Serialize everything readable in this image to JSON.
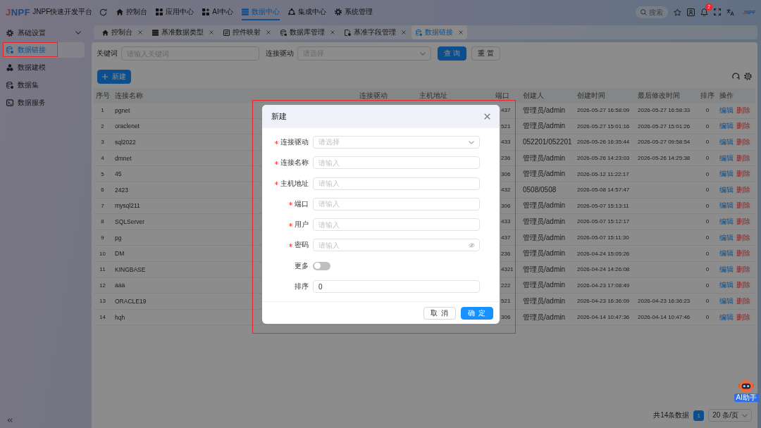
{
  "topbar": {
    "logo": "JNPF",
    "app_title": "JNPF快速开发平台",
    "nav": [
      {
        "label": "控制台",
        "selected": false
      },
      {
        "label": "应用中心",
        "selected": false
      },
      {
        "label": "AI中心",
        "selected": false
      },
      {
        "label": "数据中心",
        "selected": true
      },
      {
        "label": "集成中心",
        "selected": false
      },
      {
        "label": "系统管理",
        "selected": false
      }
    ],
    "search": {
      "placeholder": "搜索"
    },
    "notification_badge": "2",
    "corner_logo": "JNPF"
  },
  "sidebar": {
    "group": {
      "label": "基础设置",
      "expanded": false
    },
    "items": [
      {
        "label": "数据链接",
        "selected": true,
        "highlighted": true
      },
      {
        "label": "数据建模",
        "selected": false,
        "highlighted": false
      },
      {
        "label": "数据集",
        "selected": false,
        "highlighted": false
      },
      {
        "label": "数据服务",
        "selected": false,
        "highlighted": false
      }
    ]
  },
  "tabs": [
    {
      "label": "控制台",
      "selected": false
    },
    {
      "label": "基准数据类型",
      "selected": false
    },
    {
      "label": "控件映射",
      "selected": false
    },
    {
      "label": "数据库管理",
      "selected": false
    },
    {
      "label": "基准字段管理",
      "selected": false
    },
    {
      "label": "数据链接",
      "selected": true
    }
  ],
  "filters": {
    "fields": [
      {
        "label": "关键词",
        "kind": "input",
        "placeholder": "请输入关键词"
      },
      {
        "label": "连接驱动",
        "kind": "select",
        "placeholder": "请选择"
      }
    ],
    "buttons": [
      {
        "label": "查 询",
        "kind": "primary"
      },
      {
        "label": "重 置",
        "kind": "default"
      }
    ]
  },
  "toolbar": {
    "new_button": "新建"
  },
  "table": {
    "columns": [
      "序号",
      "连接名称",
      "连接驱动",
      "主机地址",
      "端口",
      "创建人",
      "创建时间",
      "最后修改时间",
      "排序",
      "操作"
    ],
    "rows": [
      {
        "no": "1",
        "name": "pgnet",
        "port": "437",
        "creator": "管理员/admin",
        "created": "2026-05-27 16:58:09",
        "modified": "2026-05-27 16:58:33",
        "sort": "0",
        "actions": [
          {
            "label": "编辑",
            "kind": "primary"
          },
          {
            "label": "删除",
            "kind": "danger"
          }
        ]
      },
      {
        "no": "2",
        "name": "oraclenet",
        "port": "521",
        "creator": "管理员/admin",
        "created": "2026-05-27 15:01:16",
        "modified": "2026-05-27 15:01:26",
        "sort": "0",
        "actions": [
          {
            "label": "编辑",
            "kind": "primary"
          },
          {
            "label": "删除",
            "kind": "danger"
          }
        ]
      },
      {
        "no": "3",
        "name": "sql2022",
        "port": "433",
        "creator": "052201/052201",
        "created": "2026-05-26 16:35:44",
        "modified": "2026-05-27 09:58:54",
        "sort": "0",
        "actions": [
          {
            "label": "编辑",
            "kind": "primary"
          },
          {
            "label": "删除",
            "kind": "danger"
          }
        ]
      },
      {
        "no": "4",
        "name": "dmnet",
        "port": "236",
        "creator": "管理员/admin",
        "created": "2026-05-26 14:23:03",
        "modified": "2026-05-26 14:25:38",
        "sort": "0",
        "actions": [
          {
            "label": "编辑",
            "kind": "primary"
          },
          {
            "label": "删除",
            "kind": "danger"
          }
        ]
      },
      {
        "no": "5",
        "name": "45",
        "port": "306",
        "creator": "管理员/admin",
        "created": "2026-05-12 11:22:17",
        "sort": "0",
        "actions": [
          {
            "label": "编辑",
            "kind": "primary"
          },
          {
            "label": "删除",
            "kind": "danger"
          }
        ]
      },
      {
        "no": "6",
        "name": "2423",
        "port": "432",
        "creator": "0508/0508",
        "created": "2026-05-08 14:57:47",
        "sort": "0",
        "actions": [
          {
            "label": "编辑",
            "kind": "primary"
          },
          {
            "label": "删除",
            "kind": "danger"
          }
        ]
      },
      {
        "no": "7",
        "name": "mysql211",
        "port": "306",
        "creator": "管理员/admin",
        "created": "2026-05-07 15:13:11",
        "sort": "0",
        "actions": [
          {
            "label": "编辑",
            "kind": "primary"
          },
          {
            "label": "删除",
            "kind": "danger"
          }
        ]
      },
      {
        "no": "8",
        "name": "SQLServer",
        "port": "433",
        "creator": "管理员/admin",
        "created": "2026-05-07 15:12:17",
        "sort": "0",
        "actions": [
          {
            "label": "编辑",
            "kind": "primary"
          },
          {
            "label": "删除",
            "kind": "danger"
          }
        ]
      },
      {
        "no": "9",
        "name": "pg",
        "port": "437",
        "creator": "管理员/admin",
        "created": "2026-05-07 15:11:30",
        "sort": "0",
        "actions": [
          {
            "label": "编辑",
            "kind": "primary"
          },
          {
            "label": "删除",
            "kind": "danger"
          }
        ]
      },
      {
        "no": "10",
        "name": "DM",
        "port": "236",
        "creator": "管理员/admin",
        "created": "2026-04-24 15:05:26",
        "sort": "0",
        "actions": [
          {
            "label": "编辑",
            "kind": "primary"
          },
          {
            "label": "删除",
            "kind": "danger"
          }
        ]
      },
      {
        "no": "11",
        "name": "KINGBASE",
        "port": "4321",
        "creator": "管理员/admin",
        "created": "2026-04-24 14:26:08",
        "sort": "0",
        "actions": [
          {
            "label": "编辑",
            "kind": "primary"
          },
          {
            "label": "删除",
            "kind": "danger"
          }
        ]
      },
      {
        "no": "12",
        "name": "aaa",
        "port": "222",
        "creator": "管理员/admin",
        "created": "2026-04-23 17:08:49",
        "sort": "0",
        "actions": [
          {
            "label": "编辑",
            "kind": "primary"
          },
          {
            "label": "删除",
            "kind": "danger"
          }
        ]
      },
      {
        "no": "13",
        "name": "ORACLE19",
        "port": "521",
        "creator": "管理员/admin",
        "created": "2026-04-23 16:36:09",
        "modified": "2026-04-23 16:36:23",
        "sort": "0",
        "actions": [
          {
            "label": "编辑",
            "kind": "primary"
          },
          {
            "label": "删除",
            "kind": "danger"
          }
        ]
      },
      {
        "no": "14",
        "name": "hqh",
        "port": "306",
        "creator": "管理员/admin",
        "created": "2026-04-14 10:47:36",
        "modified": "2026-04-14 10:47:46",
        "sort": "0",
        "actions": [
          {
            "label": "编辑",
            "kind": "primary"
          },
          {
            "label": "删除",
            "kind": "danger"
          }
        ]
      }
    ]
  },
  "pagination": {
    "total": "共14条数据",
    "pages": [
      {
        "label": "1",
        "selected": true
      }
    ],
    "page_size": "20 条/页"
  },
  "ai_assistant": {
    "label": "AI助手"
  },
  "dialog": {
    "title": "新建",
    "highlighted": true,
    "fields": [
      {
        "label": "连接驱动",
        "required": true,
        "kind": "select",
        "placeholder": "请选择"
      },
      {
        "label": "连接名称",
        "required": true,
        "kind": "input",
        "placeholder": "请输入"
      },
      {
        "label": "主机地址",
        "required": true,
        "kind": "input",
        "placeholder": "请输入"
      },
      {
        "label": "端口",
        "required": true,
        "kind": "input",
        "placeholder": "请输入"
      },
      {
        "label": "用户",
        "required": true,
        "kind": "input",
        "placeholder": "请输入"
      },
      {
        "label": "密码",
        "required": true,
        "kind": "password",
        "placeholder": "请输入"
      },
      {
        "label": "更多",
        "required": false,
        "kind": "switch",
        "on": false
      },
      {
        "label": "排序",
        "required": false,
        "kind": "input",
        "value": "0"
      }
    ],
    "buttons": [
      {
        "label": "取 消",
        "kind": "default"
      },
      {
        "label": "确 定",
        "kind": "primary"
      }
    ]
  }
}
